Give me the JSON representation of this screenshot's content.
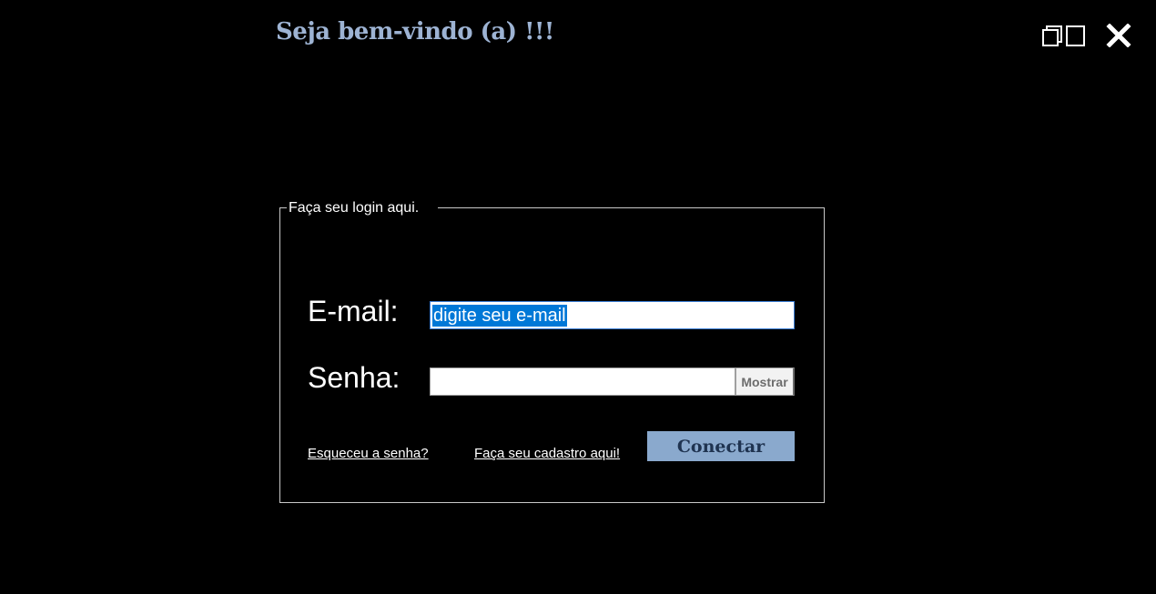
{
  "header": {
    "title": "Seja bem-vindo (a) !!!"
  },
  "window_controls": {
    "restore_icon": "restore-window-icon",
    "close_icon": "close-x-icon"
  },
  "login": {
    "legend": "Faça seu login aqui.",
    "email_label": "E-mail:",
    "email_value": "digite seu e-mail",
    "senha_label": "Senha:",
    "senha_value": "",
    "show_button": "Mostrar",
    "forgot_link": "Esqueceu a senha?",
    "signup_link": "Faça seu cadastro aqui!",
    "connect_button": "Conectar"
  },
  "colors": {
    "background": "#000000",
    "title": "#9db3d3",
    "connect_button_bg": "#8aa9cd",
    "connect_button_text": "#1f3350",
    "selection": "#0078d7"
  }
}
